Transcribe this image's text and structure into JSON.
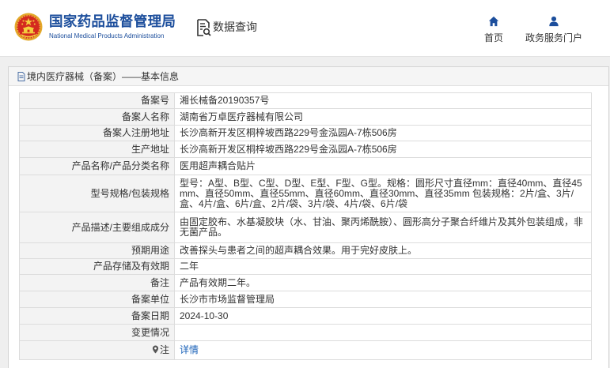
{
  "header": {
    "logo": {
      "icon": "national-emblem-icon"
    },
    "org_name_cn": "国家药品监督管理局",
    "org_name_en": "National Medical Products Administration",
    "data_query": {
      "icon": "data-search-icon",
      "label": "数据查询"
    },
    "nav": [
      {
        "icon": "home-icon",
        "label": "首页"
      },
      {
        "icon": "user-icon",
        "label": "政务服务门户"
      }
    ]
  },
  "panel": {
    "icon": "document-icon",
    "title": "境内医疗器械（备案）——基本信息"
  },
  "record": {
    "rows": [
      {
        "label": "备案号",
        "value": "湘长械备20190357号"
      },
      {
        "label": "备案人名称",
        "value": "湖南省万卓医疗器械有限公司"
      },
      {
        "label": "备案人注册地址",
        "value": "长沙高新开发区桐梓坡西路229号金泓园A-7栋506房"
      },
      {
        "label": "生产地址",
        "value": "长沙高新开发区桐梓坡西路229号金泓园A-7栋506房"
      },
      {
        "label": "产品名称/产品分类名称",
        "value": "医用超声耦合贴片"
      },
      {
        "label": "型号规格/包装规格",
        "value": "型号：A型、B型、C型、D型、E型、F型、G型。规格：圆形尺寸直径mm：直径40mm、直径45mm、直径50mm、直径55mm、直径60mm、直径30mm、直径35mm 包装规格：2片/盒、3片/盒、4片/盒、6片/盒、2片/袋、3片/袋、4片/袋、6片/袋"
      },
      {
        "label": "产品描述/主要组成成分",
        "value": "由固定胶布、水基凝胶块（水、甘油、聚丙烯酰胺）、圆形高分子聚合纤维片及其外包装组成，非无菌产品。"
      },
      {
        "label": "预期用途",
        "value": "改善探头与患者之间的超声耦合效果。用于完好皮肤上。"
      },
      {
        "label": "产品存储及有效期",
        "value": "二年"
      },
      {
        "label": "备注",
        "value": "产品有效期二年。"
      },
      {
        "label": "备案单位",
        "value": "长沙市市场监督管理局"
      },
      {
        "label": "备案日期",
        "value": "2024-10-30"
      },
      {
        "label": "变更情况",
        "value": ""
      }
    ],
    "note": {
      "icon": "pin-icon",
      "label": "注",
      "link_text": "详情"
    }
  },
  "colors": {
    "brand_blue": "#1c4e9c",
    "link_blue": "#1a62b8",
    "label_bg": "#f3f3f3",
    "border": "#dcdcdc"
  }
}
